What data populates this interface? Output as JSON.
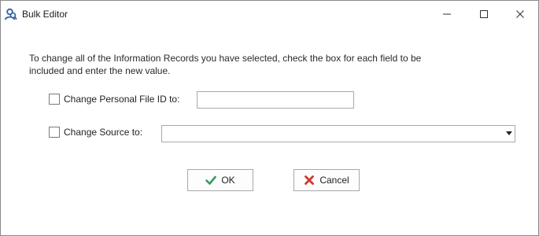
{
  "window": {
    "title": "Bulk Editor",
    "controls": {
      "minimize": "minimize-icon",
      "maximize": "maximize-icon",
      "close": "close-icon"
    }
  },
  "form": {
    "instructions": "To change all of the Information Records you have selected, check the box for each field to be included and enter the new value.",
    "fields": [
      {
        "label": "Change Personal File ID to:",
        "checked": false,
        "value": ""
      },
      {
        "label": "Change Source to:",
        "checked": false,
        "value": ""
      }
    ]
  },
  "buttons": {
    "ok": {
      "label": "OK",
      "icon": "checkmark-icon",
      "color": "#3a9a5b"
    },
    "cancel": {
      "label": "Cancel",
      "icon": "x-icon",
      "color": "#d2392f"
    }
  }
}
